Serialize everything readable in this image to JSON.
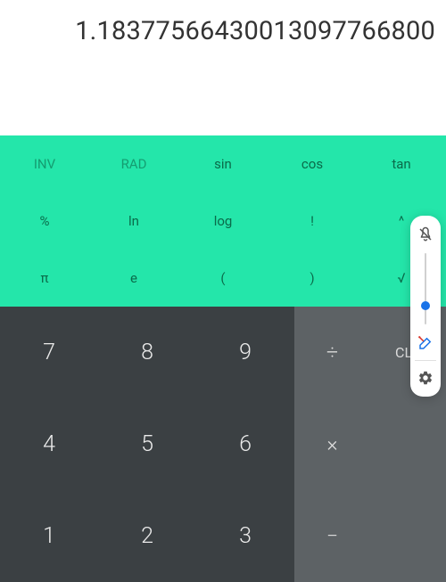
{
  "display": {
    "value": "1.18377566430013097766800"
  },
  "sci": {
    "row1": [
      "INV",
      "RAD",
      "sin",
      "cos",
      "tan"
    ],
    "row2": [
      "%",
      "ln",
      "log",
      "!",
      "^"
    ],
    "row3": [
      "π",
      "e",
      "(",
      ")",
      "√"
    ]
  },
  "numpad": {
    "r1": [
      "7",
      "8",
      "9"
    ],
    "r2": [
      "4",
      "5",
      "6"
    ],
    "r3": [
      "1",
      "2",
      "3"
    ]
  },
  "ops": {
    "divide": "÷",
    "clear": "CLR",
    "multiply": "×",
    "minus": "−"
  },
  "slider": {
    "position": 54
  }
}
